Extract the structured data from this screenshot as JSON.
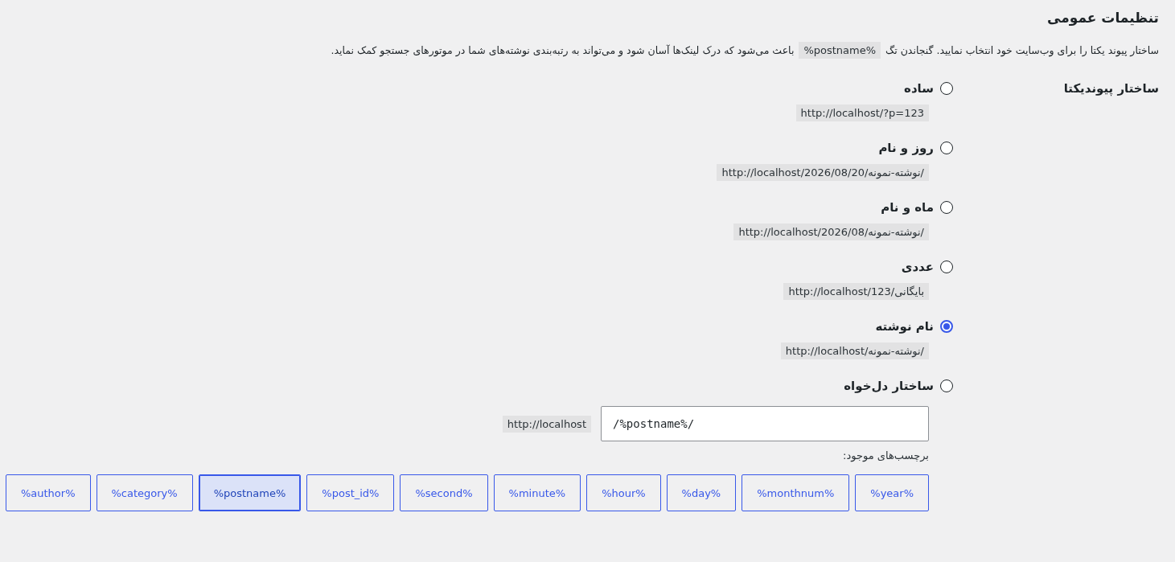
{
  "page": {
    "title": "تنظیمات عمومی",
    "description": {
      "before": "ساختار پیوند یکتا را برای وب‌سایت خود انتخاب نمایید. گنجاندن تگ",
      "code": "%postname%",
      "after": "باعث می‌شود که درک لینک‌ها آسان شود و می‌تواند به رتبه‌بندی نوشته‌های شما در موتورهای جستجو کمک نماید."
    }
  },
  "permalink": {
    "label": "ساختار پیوندیکتا",
    "options": [
      {
        "label": "ساده",
        "example": "http://localhost/?p=123",
        "selected": false
      },
      {
        "label": "روز و نام",
        "example": "http://localhost/2026/08/20/نوشته-نمونه/",
        "selected": false
      },
      {
        "label": "ماه و نام",
        "example": "http://localhost/2026/08/نوشته-نمونه/",
        "selected": false
      },
      {
        "label": "عددی",
        "example": "http://localhost/بایگانی/123",
        "selected": false
      },
      {
        "label": "نام نوشته",
        "example": "http://localhost/نوشته-نمونه/",
        "selected": true
      },
      {
        "label": "ساختار دل‌خواه",
        "selected": false
      }
    ],
    "custom": {
      "prefix": "http://localhost",
      "value": "/%postname%/",
      "tags_label": "برچسب‌های موجود:",
      "tags": [
        {
          "label": "%year%",
          "selected": false
        },
        {
          "label": "%monthnum%",
          "selected": false
        },
        {
          "label": "%day%",
          "selected": false
        },
        {
          "label": "%hour%",
          "selected": false
        },
        {
          "label": "%minute%",
          "selected": false
        },
        {
          "label": "%second%",
          "selected": false
        },
        {
          "label": "%post_id%",
          "selected": false
        },
        {
          "label": "%postname%",
          "selected": true
        },
        {
          "label": "%category%",
          "selected": false
        },
        {
          "label": "%author%",
          "selected": false
        }
      ]
    }
  }
}
